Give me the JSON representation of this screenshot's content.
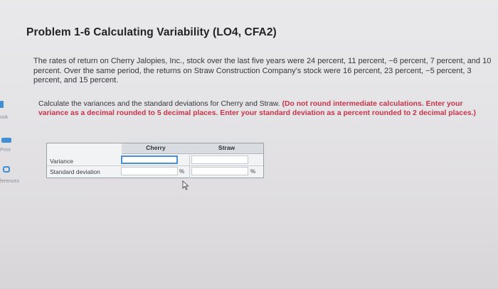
{
  "sidebar": {
    "items": [
      {
        "label": "ook",
        "icon": "book-icon"
      },
      {
        "label": "Print",
        "icon": "print-icon"
      },
      {
        "label": "ferences",
        "icon": "references-icon"
      }
    ]
  },
  "problem": {
    "title": "Problem 1-6 Calculating Variability (LO4, CFA2)",
    "statement": "The rates of return on Cherry Jalopies, Inc., stock over the last five years were 24 percent, 11 percent, −6 percent, 7 percent, and 10 percent. Over the same period, the returns on Straw Construction Company's stock were 16 percent, 23 percent, −5 percent, 3 percent, and 15 percent.",
    "instruction": "Calculate the variances and the standard deviations for Cherry and Straw.",
    "instruction_note": "(Do not round intermediate calculations. Enter your variance as a decimal rounded to 5 decimal places. Enter your standard deviation as a percent rounded to 2 decimal places.)"
  },
  "table": {
    "columns": [
      "Cherry",
      "Straw"
    ],
    "rows": [
      {
        "label": "Variance",
        "cherry": "",
        "straw": "",
        "unit": ""
      },
      {
        "label": "Standard deviation",
        "cherry": "",
        "straw": "",
        "unit": "%"
      }
    ]
  },
  "colors": {
    "accent": "#4a8fd3",
    "note_red": "#c8344a",
    "icon_blue": "#3f8fd2"
  }
}
